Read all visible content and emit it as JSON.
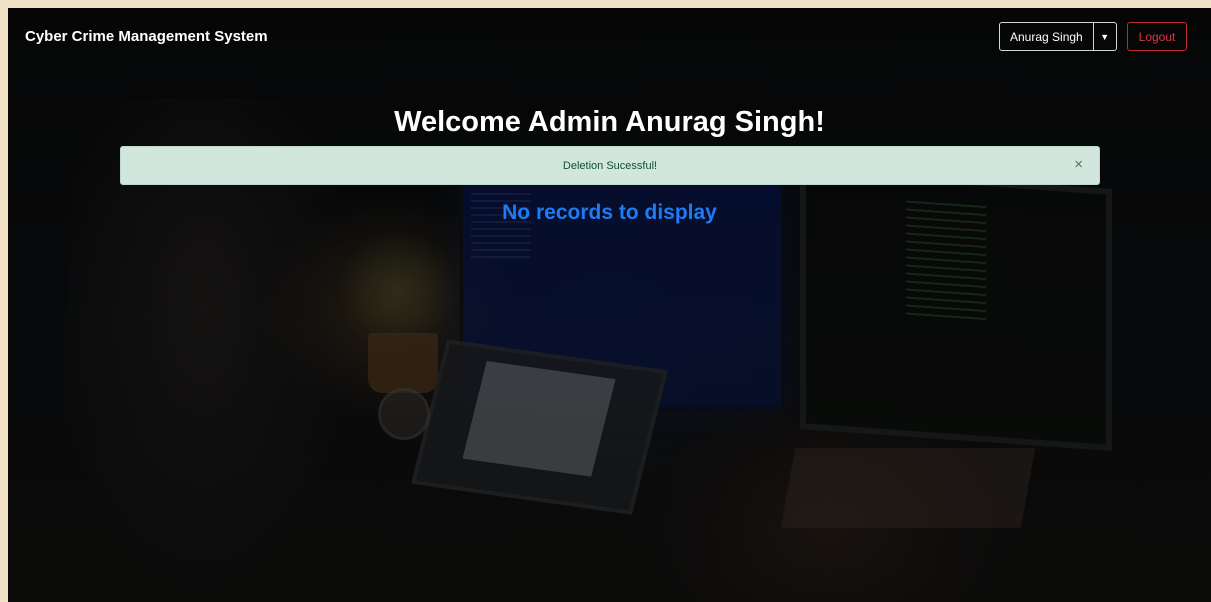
{
  "navbar": {
    "brand": "Cyber Crime Management System",
    "user_name": "Anurag Singh",
    "dropdown_icon": "caret-down-icon",
    "logout_label": "Logout"
  },
  "main": {
    "welcome_text": "Welcome Admin Anurag Singh!",
    "alert": {
      "message": "Deletion Sucessful!",
      "close_symbol": "×",
      "close_icon": "close-icon"
    },
    "empty_message": "No records to display"
  },
  "colors": {
    "alert_bg": "#d1e7dd",
    "alert_text": "#0f5132",
    "empty_message": "#1e7bf3",
    "logout": "#dc3545",
    "page_border": "#f1e2c6"
  }
}
